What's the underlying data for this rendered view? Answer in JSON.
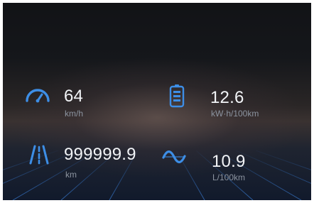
{
  "dashboard": {
    "speed": {
      "icon": "speedometer-icon",
      "value": "64",
      "unit": "km/h"
    },
    "energy": {
      "icon": "battery-icon",
      "value": "12.6",
      "unit": "kW·h/100km"
    },
    "odometer": {
      "icon": "road-icon",
      "value": "999999.9",
      "unit": "km"
    },
    "fuel": {
      "icon": "wave-icon",
      "value": "10.9",
      "unit": "L/100km"
    }
  },
  "colors": {
    "icon_blue": "#3d8ee6",
    "value_text": "#f2f4f7",
    "unit_text": "#8c94a0",
    "grid_line": "#2f6fc4"
  }
}
